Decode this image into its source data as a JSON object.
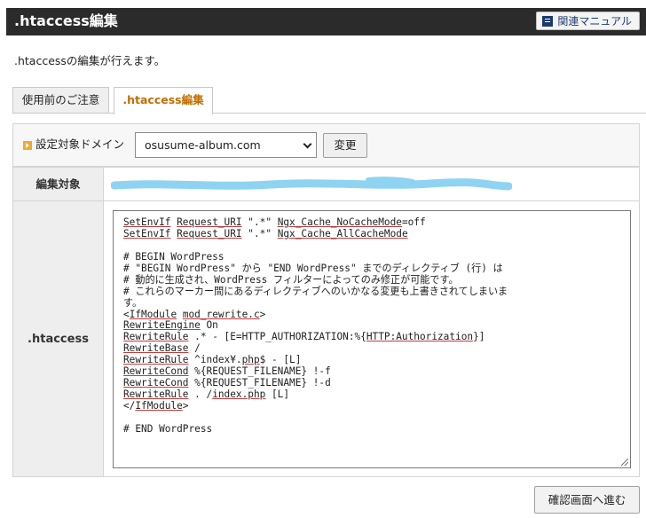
{
  "header": {
    "title": ".htaccess編集",
    "manual_label": "関連マニュアル"
  },
  "description": ".htaccessの編集が行えます。",
  "tabs": [
    {
      "label": "使用前のご注意",
      "active": false
    },
    {
      "label": ".htaccess編集",
      "active": true
    }
  ],
  "domain": {
    "label": "設定対象ドメイン",
    "selected": "osusume-album.com",
    "change_label": "変更"
  },
  "table": {
    "target_label": "編集対象",
    "target_value": "",
    "htaccess_label": ".htaccess"
  },
  "editor": {
    "lines": [
      [
        {
          "t": "SetEnvIf",
          "u": true
        },
        {
          "t": " "
        },
        {
          "t": "Request_URI",
          "u": true
        },
        {
          "t": " \".*\" "
        },
        {
          "t": "Ngx_Cache_NoCacheMode",
          "u": true
        },
        {
          "t": "=off"
        }
      ],
      [
        {
          "t": "SetEnvIf",
          "u": true
        },
        {
          "t": " "
        },
        {
          "t": "Request_URI",
          "u": true
        },
        {
          "t": " \".*\" "
        },
        {
          "t": "Ngx_Cache_AllCacheMode",
          "u": true
        }
      ],
      [
        {
          "t": ""
        }
      ],
      [
        {
          "t": "# BEGIN WordPress"
        }
      ],
      [
        {
          "t": "# \"BEGIN WordPress\" から \"END WordPress\" までのディレクティブ (行) は"
        }
      ],
      [
        {
          "t": "# 動的に生成され、WordPress フィルターによってのみ修正が可能です。"
        }
      ],
      [
        {
          "t": "# これらのマーカー間にあるディレクティブへのいかなる変更も上書きされてしまいま"
        }
      ],
      [
        {
          "t": "す。"
        }
      ],
      [
        {
          "t": "<"
        },
        {
          "t": "IfModule",
          "u": true
        },
        {
          "t": " "
        },
        {
          "t": "mod_rewrite.c",
          "u": true
        },
        {
          "t": ">"
        }
      ],
      [
        {
          "t": "RewriteEngine",
          "u": true
        },
        {
          "t": " On"
        }
      ],
      [
        {
          "t": "RewriteRule",
          "u": true
        },
        {
          "t": " .* - [E=HTTP_AUTHORIZATION:%{"
        },
        {
          "t": "HTTP:Authorization",
          "u": true
        },
        {
          "t": "}]"
        }
      ],
      [
        {
          "t": "RewriteBase",
          "u": true
        },
        {
          "t": " /"
        }
      ],
      [
        {
          "t": "RewriteRule",
          "u": true
        },
        {
          "t": " ^index¥."
        },
        {
          "t": "php",
          "u": true
        },
        {
          "t": "$ - [L]"
        }
      ],
      [
        {
          "t": "RewriteCond",
          "u": true
        },
        {
          "t": " %{REQUEST_FILENAME} !-f"
        }
      ],
      [
        {
          "t": "RewriteCond",
          "u": true
        },
        {
          "t": " %{REQUEST_FILENAME} !-d"
        }
      ],
      [
        {
          "t": "RewriteRule",
          "u": true
        },
        {
          "t": " . /"
        },
        {
          "t": "index.php",
          "u": true
        },
        {
          "t": " [L]"
        }
      ],
      [
        {
          "t": "</"
        },
        {
          "t": "IfModule",
          "u": true
        },
        {
          "t": ">"
        }
      ],
      [
        {
          "t": ""
        }
      ],
      [
        {
          "t": "# END WordPress"
        }
      ]
    ]
  },
  "confirm_label": "確認画面へ進む",
  "colors": {
    "header_bg": "#2b2b2b",
    "active_tab_text": "#c06e00",
    "redaction": "#8fd3f2",
    "underline": "#c43b3b"
  }
}
